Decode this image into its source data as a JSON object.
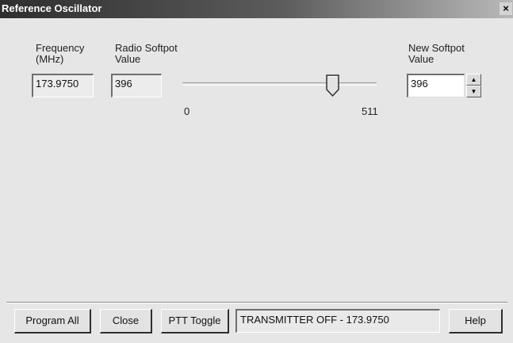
{
  "window": {
    "title": "Reference Oscillator",
    "close_glyph": "×"
  },
  "labels": {
    "frequency": "Frequency\n(MHz)",
    "radio_softpot": "Radio Softpot\nValue",
    "new_softpot": "New Softpot\nValue"
  },
  "fields": {
    "frequency": "173.9750",
    "radio_softpot": "396"
  },
  "slider": {
    "min": 0,
    "max": 511,
    "value": 396,
    "min_label": "0",
    "max_label": "511"
  },
  "spinner": {
    "value": "396",
    "up_glyph": "▲",
    "down_glyph": "▼"
  },
  "buttons": {
    "program_all": "Program All",
    "close": "Close",
    "ptt_toggle": "PTT Toggle",
    "help": "Help"
  },
  "status": {
    "text": "TRANSMITTER OFF - 173.9750"
  }
}
